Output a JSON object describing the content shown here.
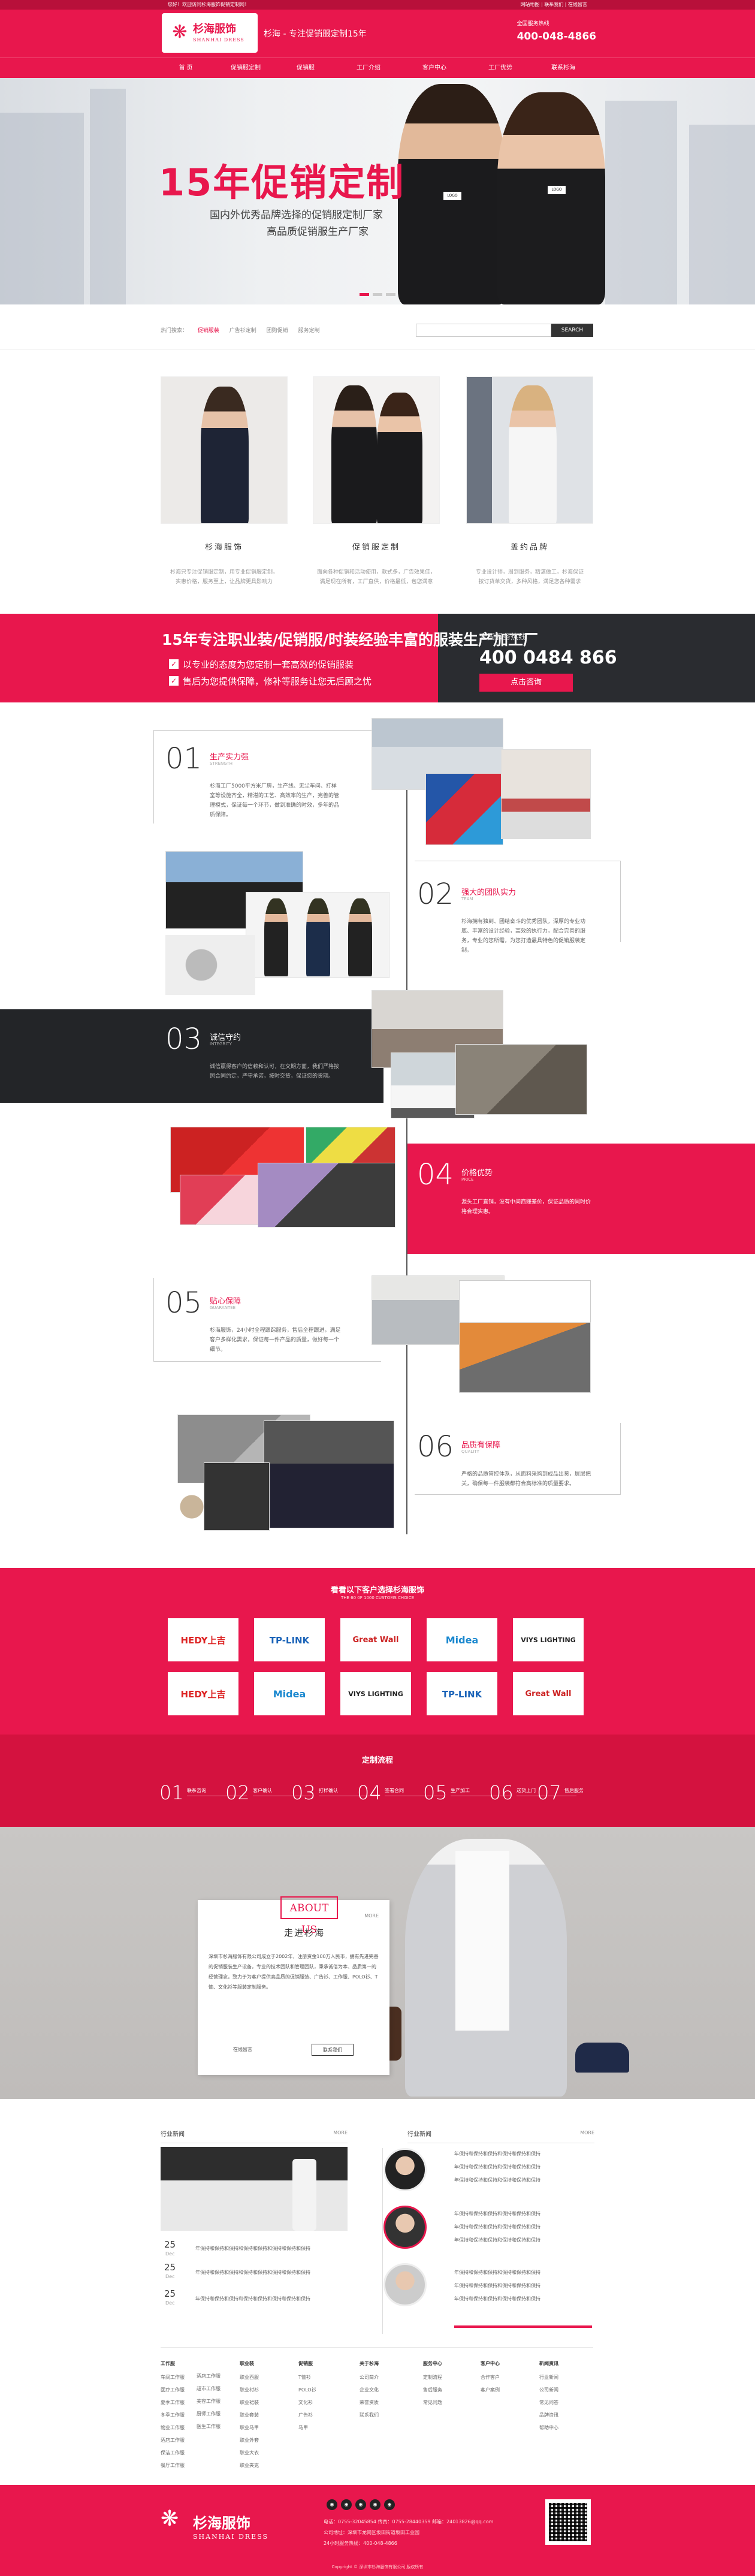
{
  "topbar": {
    "left": "您好！欢迎访问杉海服饰促销定制网！",
    "right": "网站地图 | 联系我们 | 在线留言"
  },
  "header": {
    "brand_cn": "杉海服饰",
    "brand_en": "SHANHAI DRESS",
    "slogan": "杉海 - 专注促销服定制15年",
    "hotline_label": "全国服务热线",
    "hotline": "400-048-4866"
  },
  "nav": [
    "首 页",
    "促销服定制",
    "促销服",
    "工厂介绍",
    "客户中心",
    "工厂优势",
    "联系杉海"
  ],
  "banner": {
    "title": "15年促销定制",
    "line1": "国内外优秀品牌选择的促销服定制厂家",
    "line2": "高品质促销服生产厂家",
    "dots": 3,
    "active_dot": 0
  },
  "search": {
    "hot_label": "热门搜索：",
    "hot": [
      "促销服装",
      "广告衫定制",
      "团购促销",
      "服务定制"
    ],
    "placeholder": "",
    "button": "SEARCH"
  },
  "brands": [
    {
      "name": "杉海服饰",
      "desc1": "杉海只专注促销服定制，用专业促销服定制，",
      "desc2": "实惠价格，服务至上，让品牌更具影响力"
    },
    {
      "name": "促销服定制",
      "desc1": "面向各种促销和活动使用，款式多，广告效果佳，",
      "desc2": "满足现在所有，工厂直供，价格最低，包您满意"
    },
    {
      "name": "盖约品牌",
      "desc1": "专业设计师，周到服务，精湛做工，杉海保证",
      "desc2": "按订货单交货，多种风格，满足您各种需求"
    }
  ],
  "promo": {
    "title": "15年专注职业装/促销服/时装经验丰富的服装生产加工厂",
    "c1": "以专业的态度为您定制一套高效的促销服装",
    "c2": "售后为您提供保障，修补等服务让您无后顾之忧",
    "hot_label": "全国服务热线",
    "hot_num": "400 0484 866",
    "btn": "点击咨询"
  },
  "advantages": [
    {
      "num": "01",
      "title": "生产实力强",
      "en": "STRENGTH",
      "text": "杉海工厂5000平方米厂房，生产线、无尘车间、打样室等设施齐全，精湛的工艺、高效率的生产，完善的管理模式，保证每一个环节，做到准确的时效，多年的品质保障。"
    },
    {
      "num": "02",
      "title": "强大的团队实力",
      "en": "TEAM",
      "text": "杉海拥有独到、团结奋斗的优秀团队，深厚的专业功底、丰富的设计经验，高效的执行力，配合完善的服务，专业的您所需，为您打造最具特色的促销服装定制。"
    },
    {
      "num": "03",
      "title": "诚信守约",
      "en": "INTEGRITY",
      "text": "诚信赢得客户的信赖和认可，在交期方面，我们严格按照合同约定，严守承诺，按时交货，保证您的货期。"
    },
    {
      "num": "04",
      "title": "价格优势",
      "en": "PRICE",
      "text": "源头工厂直销，没有中间商赚差价，保证品质的同时价格合理实惠。"
    },
    {
      "num": "05",
      "title": "贴心保障",
      "en": "GUARANTEE",
      "text": "杉海服饰，24小时全程跟踪服务，售后全程跟进，满足客户多样化需求，保证每一件产品的质量，做好每一个细节。"
    },
    {
      "num": "06",
      "title": "品质有保障",
      "en": "QUALITY",
      "text": "严格的品质管控体系，从面料采购到成品出货，层层把关，确保每一件服装都符合高标准的质量要求。"
    }
  ],
  "clients": {
    "title": "看看以下客户选择杉海服饰",
    "sub": "THE 60 0F 1000 CUSTOMS CHOICE",
    "row1": [
      "HEDY上吉",
      "TP-LINK",
      "Great Wall",
      "Midea",
      "VIYS LIGHTING"
    ],
    "row2": [
      "HEDY上吉",
      "Midea",
      "VIYS LIGHTING",
      "TP-LINK",
      "Great Wall"
    ]
  },
  "process": {
    "title": "定制流程",
    "steps": [
      {
        "n": "01",
        "l": "联系咨询"
      },
      {
        "n": "02",
        "l": "客户确认"
      },
      {
        "n": "03",
        "l": "打样确认"
      },
      {
        "n": "04",
        "l": "签署合同"
      },
      {
        "n": "05",
        "l": "生产加工"
      },
      {
        "n": "06",
        "l": "送货上门"
      },
      {
        "n": "07",
        "l": "售后服务"
      }
    ]
  },
  "about": {
    "en": "ABOUT US",
    "cn": "走进杉海",
    "more": "MORE",
    "text": "深圳市杉海服饰有限公司成立于2002年，注册资金100万人民币，拥有先进完善的促销服装生产设备，专业的技术团队和管理团队，秉承诚信为本、品质第一的经营理念，致力于为客户提供高品质的促销服装、广告衫、工作服、POLO衫、T恤、文化衫等服装定制服务。",
    "b1": "在线留言",
    "b2": "联系我们"
  },
  "news": {
    "left_title": "行业新闻",
    "right_title": "行业新闻",
    "more": "MORE",
    "left_items": [
      {
        "d": "25",
        "m": "Dec",
        "t": "年保持和保持和保持和保持和保持和保持和保持和保持"
      },
      {
        "d": "25",
        "m": "Dec",
        "t": "年保持和保持和保持和保持和保持和保持和保持和保持"
      },
      {
        "d": "25",
        "m": "Dec",
        "t": "年保持和保持和保持和保持和保持和保持和保持和保持"
      }
    ],
    "right_items": [
      "年保持和保持和保持和保持和保持和保持",
      "年保持和保持和保持和保持和保持和保持",
      "年保持和保持和保持和保持和保持和保持",
      "年保持和保持和保持和保持和保持和保持",
      "年保持和保持和保持和保持和保持和保持",
      "年保持和保持和保持和保持和保持和保持",
      "年保持和保持和保持和保持和保持和保持",
      "年保持和保持和保持和保持和保持和保持",
      "年保持和保持和保持和保持和保持和保持"
    ]
  },
  "footnav": [
    {
      "h": "工作服",
      "i": [
        "车间工作服",
        "医疗工作服",
        "夏季工作服",
        "冬季工作服",
        "物业工作服",
        "酒店工作服",
        "保洁工作服",
        "餐厅工作服"
      ]
    },
    {
      "h": "",
      "i": [
        "酒店工作服",
        "超市工作服",
        "美容工作服",
        "厨师工作服",
        "医生工作服"
      ]
    },
    {
      "h": "职业装",
      "i": [
        "职业西服",
        "职业衬衫",
        "职业裙装",
        "职业套装",
        "职业马甲",
        "职业外套",
        "职业大衣",
        "职业夹克"
      ]
    },
    {
      "h": "促销服",
      "i": [
        "T恤衫",
        "POLO衫",
        "文化衫",
        "广告衫",
        "马甲"
      ]
    },
    {
      "h": "关于杉海",
      "i": [
        "公司简介",
        "企业文化",
        "荣誉资质",
        "联系我们"
      ]
    },
    {
      "h": "服务中心",
      "i": [
        "定制流程",
        "售后服务",
        "常见问题"
      ]
    },
    {
      "h": "客户中心",
      "i": [
        "合作客户",
        "客户案例"
      ]
    },
    {
      "h": "新闻资讯",
      "i": [
        "行业新闻",
        "公司新闻",
        "常见问答",
        "品牌资讯",
        "帮助中心"
      ]
    }
  ],
  "footer": {
    "cn": "杉海服饰",
    "en": "SHANHAI DRESS",
    "l1": "电话：0755-32045854  传真：0755-28440359  邮箱：24013826@qq.com",
    "l2": "公司地址：深圳市龙岗区坂田街道坂田工业园",
    "l3": "24小时服务热线：400-048-4866",
    "copy": "Copyright © 深圳市杉海服饰有限公司 版权所有"
  }
}
